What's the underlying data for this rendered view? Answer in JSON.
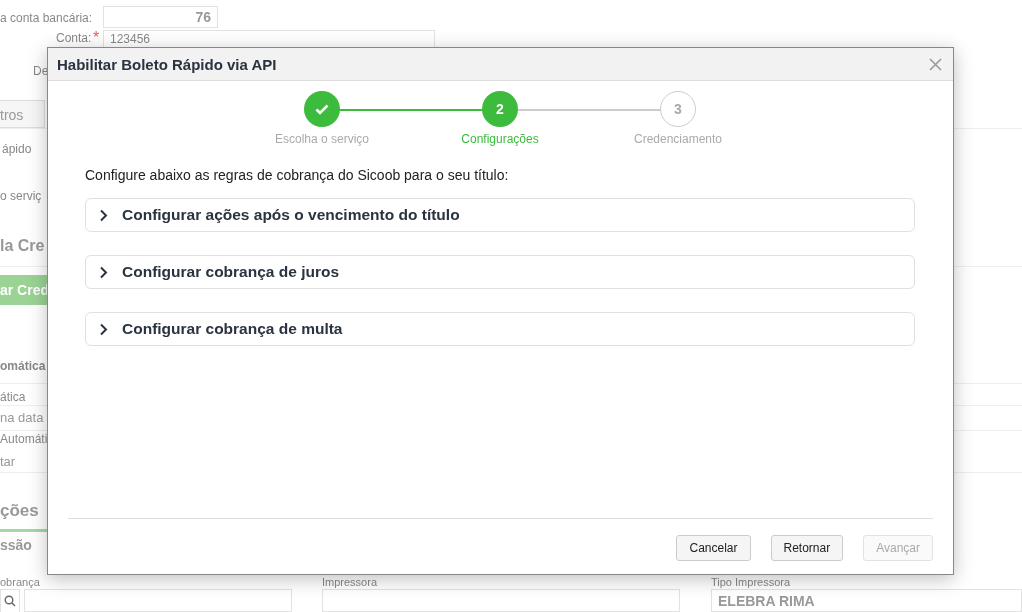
{
  "background": {
    "account_number": {
      "label": "a conta bancária:",
      "value": "76"
    },
    "account": {
      "label": "Conta:",
      "required_mark": "*",
      "value": "123456"
    },
    "description_label": "De",
    "tab": "tros",
    "text_1": "ápido",
    "text_2": "o serviç",
    "heading_1": "la Cre",
    "green_button": "ar Cred",
    "heading_2": "omática",
    "field_label_1": "ática",
    "field_value_1": "na data",
    "field_label_2": "Automáti",
    "field_value_2": "tar",
    "heading_3": "ções",
    "heading_4": "ssão",
    "bottom_fields": [
      {
        "label": "obrança",
        "kind": "search"
      },
      {
        "label": "Impressora",
        "kind": "text"
      },
      {
        "label": "Tipo Impressora",
        "kind": "text",
        "value": "ELEBRA RIMA"
      }
    ]
  },
  "dialog": {
    "title": "Habilitar Boleto Rápido via API",
    "steps": [
      {
        "label": "Escolha o serviço",
        "completed": true,
        "selected": false
      },
      {
        "label": "Configurações",
        "number": "2",
        "completed": false,
        "selected": true
      },
      {
        "label": "Credenciamento",
        "number": "3",
        "completed": false,
        "selected": false
      }
    ],
    "intro": "Configure abaixo as regras de cobrança do Sicoob para o seu título:",
    "sections": [
      {
        "title": "Configurar ações após o vencimento do título",
        "expanded": false
      },
      {
        "title": "Configurar cobrança de juros",
        "expanded": false
      },
      {
        "title": "Configurar cobrança de multa",
        "expanded": false
      }
    ],
    "buttons": [
      {
        "label": "Cancelar",
        "disabled": false
      },
      {
        "label": "Retornar",
        "disabled": false
      },
      {
        "label": "Avançar",
        "disabled": true
      }
    ]
  }
}
